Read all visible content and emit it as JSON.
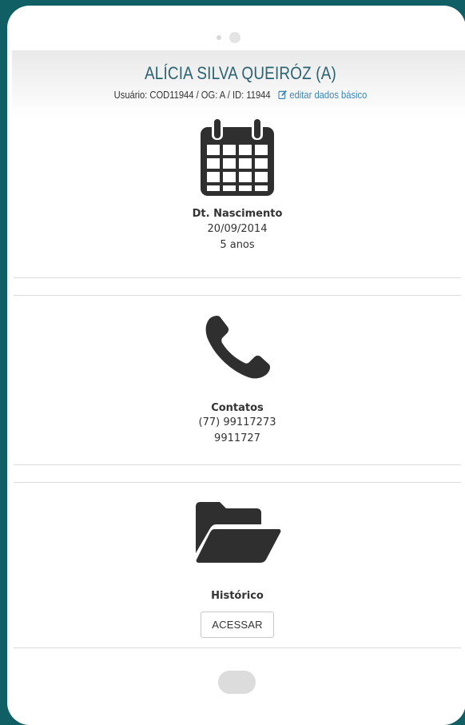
{
  "header": {
    "name": "ALÍCIA SILVA QUEIRÓZ (A)",
    "info": "Usuário: COD11944 / OG: A / ID: 11944",
    "edit_label": "editar dados básico"
  },
  "birth": {
    "icon": "calendar-icon",
    "label": "Dt. Nascimento",
    "date": "20/09/2014",
    "age": "5 anos"
  },
  "contacts": {
    "icon": "phone-icon",
    "label": "Contatos",
    "phones": [
      "(77) 99117273",
      "9911727"
    ]
  },
  "history": {
    "icon": "folder-open-icon",
    "label": "Histórico",
    "button_label": "ACESSAR"
  },
  "colors": {
    "background": "#0f5f64",
    "name": "#2c6371",
    "link": "#3b86b5",
    "icon": "#2f2f2f"
  }
}
